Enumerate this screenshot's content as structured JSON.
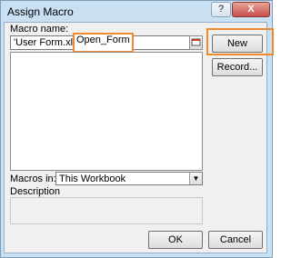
{
  "window": {
    "title": "Assign Macro",
    "help_label": "?",
    "close_label": "X"
  },
  "macro_name": {
    "label": "Macro name:",
    "value_prefix": "'User Form.xlsm'!",
    "value_selected": "Open_Form"
  },
  "buttons": {
    "new": "New",
    "record": "Record...",
    "ok": "OK",
    "cancel": "Cancel"
  },
  "macros_in": {
    "label": "Macros in:",
    "value": "This Workbook"
  },
  "description": {
    "label": "Description"
  },
  "highlight_color": "#f08a2c"
}
